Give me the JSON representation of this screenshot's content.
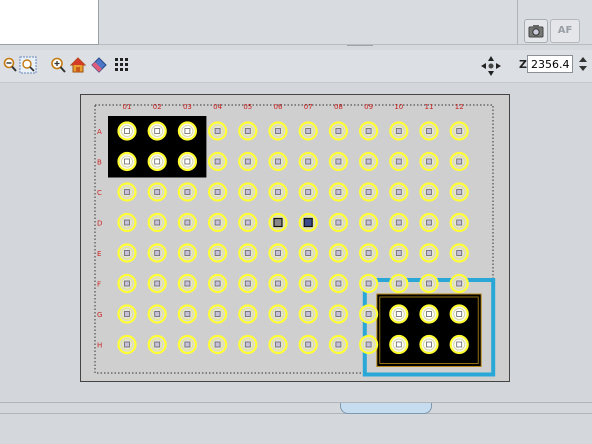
{
  "window": {
    "af_button_label": "AF"
  },
  "toolbar": {
    "icons": [
      "zoom-out-icon",
      "zoom-fit-icon",
      "zoom-in-icon",
      "home-icon",
      "clear-icon",
      "grid-icon"
    ],
    "z_label": "Z:",
    "z_value": "2356.4"
  },
  "plate": {
    "columns": [
      "01",
      "02",
      "03",
      "04",
      "05",
      "06",
      "07",
      "08",
      "09",
      "10",
      "11",
      "12"
    ],
    "rows": [
      "A",
      "B",
      "C",
      "D",
      "E",
      "F",
      "G",
      "H"
    ],
    "well_color": "#ffff33",
    "label_color": "#cc2222",
    "selection_color": "#29a8d8",
    "selected_block_left": {
      "rows": [
        "A",
        "B"
      ],
      "columns": [
        "01",
        "02",
        "03"
      ]
    },
    "selected_block_right": {
      "rows": [
        "G",
        "H"
      ],
      "columns": [
        "10",
        "11",
        "12"
      ]
    },
    "current_position_wells": [
      "D06",
      "D07"
    ]
  }
}
